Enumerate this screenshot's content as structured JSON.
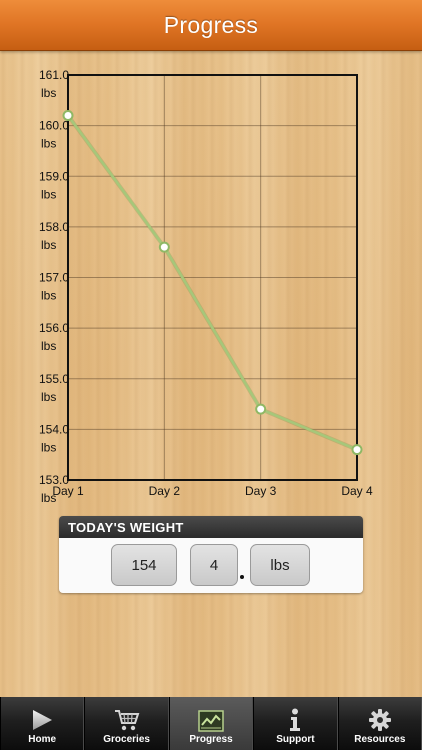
{
  "header": {
    "title": "Progress"
  },
  "chart_data": {
    "type": "line",
    "categories": [
      "Day 1",
      "Day 2",
      "Day 3",
      "Day 4"
    ],
    "values": [
      160.2,
      157.6,
      154.4,
      153.6
    ],
    "ylim": [
      153.0,
      161.0
    ],
    "yticks": [
      {
        "value": 161.0,
        "num": "161.0",
        "unit": "lbs"
      },
      {
        "value": 160.0,
        "num": "160.0",
        "unit": "lbs"
      },
      {
        "value": 159.0,
        "num": "159.0",
        "unit": "lbs"
      },
      {
        "value": 158.0,
        "num": "158.0",
        "unit": "lbs"
      },
      {
        "value": 157.0,
        "num": "157.0",
        "unit": "lbs"
      },
      {
        "value": 156.0,
        "num": "156.0",
        "unit": "lbs"
      },
      {
        "value": 155.0,
        "num": "155.0",
        "unit": "lbs"
      },
      {
        "value": 154.0,
        "num": "154.0",
        "unit": "lbs"
      },
      {
        "value": 153.0,
        "num": "153.0",
        "unit": "lbs"
      }
    ],
    "grid": true,
    "line_color": "#a6c77a",
    "marker_fill": "#ffffff"
  },
  "weight_card": {
    "title": "TODAY'S WEIGHT",
    "whole": "154",
    "decimal": "4",
    "unit": "lbs"
  },
  "tabbar": {
    "items": [
      {
        "label": "Home",
        "icon": "play-icon",
        "active": false
      },
      {
        "label": "Groceries",
        "icon": "cart-icon",
        "active": false
      },
      {
        "label": "Progress",
        "icon": "chart-icon",
        "active": true
      },
      {
        "label": "Support",
        "icon": "info-icon",
        "active": false
      },
      {
        "label": "Resources",
        "icon": "gear-icon",
        "active": false
      }
    ]
  },
  "colors": {
    "header": "#df7424",
    "tabbar": "#1f1f1f",
    "accent_green": "#a6c77a"
  }
}
